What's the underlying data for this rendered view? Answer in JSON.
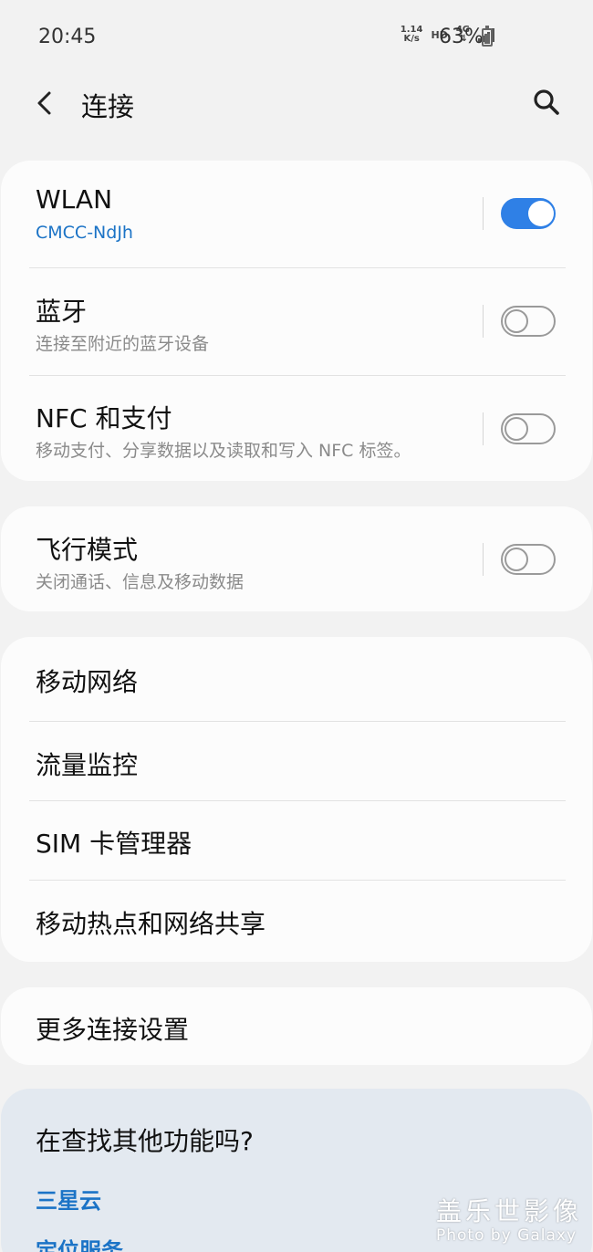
{
  "status_bar": {
    "time": "20:45",
    "net_speed_value": "1.14",
    "net_speed_unit": "K/s",
    "hd": "HD",
    "network": "4G",
    "battery": "63%"
  },
  "header": {
    "title": "连接",
    "back_icon": "chevron-left-icon",
    "search_icon": "search-icon"
  },
  "group1": {
    "wlan": {
      "title": "WLAN",
      "subtitle": "CMCC-NdJh",
      "enabled": true
    },
    "bluetooth": {
      "title": "蓝牙",
      "subtitle": "连接至附近的蓝牙设备",
      "enabled": false
    },
    "nfc": {
      "title": "NFC 和支付",
      "subtitle": "移动支付、分享数据以及读取和写入 NFC 标签。",
      "enabled": false
    }
  },
  "group2": {
    "airplane": {
      "title": "飞行模式",
      "subtitle": "关闭通话、信息及移动数据",
      "enabled": false
    }
  },
  "group3": {
    "items": [
      "移动网络",
      "流量监控",
      "SIM 卡管理器",
      "移动热点和网络共享"
    ]
  },
  "group4": {
    "more": "更多连接设置"
  },
  "suggestions": {
    "title": "在查找其他功能吗?",
    "links": [
      "三星云",
      "定位服务"
    ]
  },
  "watermark": {
    "cn": "盖乐世影像",
    "en": "Photo by Galaxy"
  },
  "colors": {
    "accent": "#1b73c6",
    "toggle_on": "#2f80e6",
    "background": "#f2f2f2",
    "card": "#fcfcfc",
    "suggest_bg": "#e3e9f0"
  }
}
